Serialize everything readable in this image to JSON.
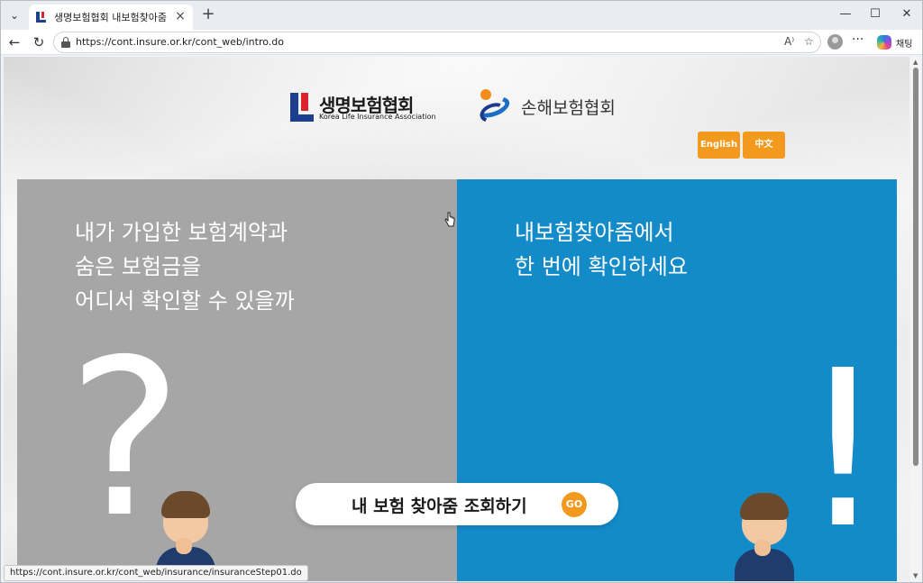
{
  "browser": {
    "tab_title": "생명보험협회 내보험찾아줌",
    "url": "https://cont.insure.or.kr/cont_web/intro.do",
    "copilot_label": "채팅",
    "status_url": "https://cont.insure.or.kr/cont_web/insurance/insuranceStep01.do"
  },
  "logos": {
    "life": {
      "korean": "생명보험협회",
      "english": "Korea Life Insurance Association"
    },
    "nonlife": {
      "korean": "손해보험협회"
    }
  },
  "language": {
    "english": "English",
    "chinese": "中文"
  },
  "left_panel": {
    "lines": [
      "내가 가입한 보험계약과",
      "숨은 보험금을",
      "어디서 확인할 수 있을까"
    ],
    "symbol": "?"
  },
  "right_panel": {
    "lines": [
      "내보험찾아줌에서",
      "한 번에 확인하세요"
    ],
    "symbol": "!"
  },
  "cta": {
    "label": "내 보험 찾아줌 조회하기",
    "go": "GO"
  },
  "colors": {
    "left_panel": "#a6a6a6",
    "right_panel": "#138bc9",
    "accent": "#f39a1e"
  }
}
